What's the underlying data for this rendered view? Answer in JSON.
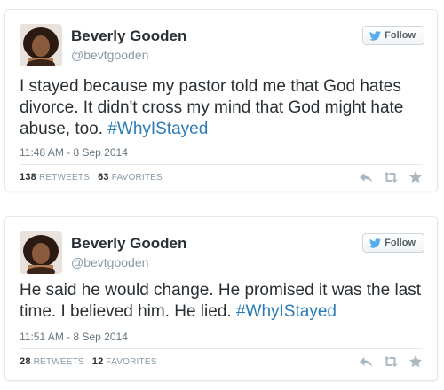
{
  "tweets": [
    {
      "author_name": "Beverly Gooden",
      "handle": "@bevtgooden",
      "follow_label": "Follow",
      "text": "I stayed because my pastor told me that God hates divorce. It didn't cross my mind that God might hate abuse, too.",
      "hashtag": "#WhyIStayed",
      "timestamp": "11:48 AM - 8 Sep 2014",
      "retweets": "138",
      "retweets_label": "RETWEETS",
      "favorites": "63",
      "favorites_label": "FAVORITES"
    },
    {
      "author_name": "Beverly Gooden",
      "handle": "@bevtgooden",
      "follow_label": "Follow",
      "text": "He said he would change. He promised it was the last time. I believed him. He lied.",
      "hashtag": "#WhyIStayed",
      "timestamp": "11:51 AM - 8 Sep 2014",
      "retweets": "28",
      "retweets_label": "RETWEETS",
      "favorites": "12",
      "favorites_label": "FAVORITES"
    }
  ],
  "icons": {
    "twitter_bird": "twitter-bird-icon",
    "reply": "reply-icon",
    "retweet": "retweet-icon",
    "favorite": "favorite-star-icon"
  },
  "colors": {
    "hashtag": "#2b7bb9",
    "twitter_blue": "#55acee",
    "muted": "#8899a6",
    "border": "#e1e8ed"
  }
}
